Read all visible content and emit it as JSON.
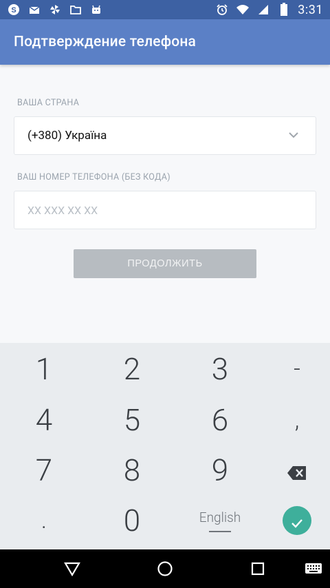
{
  "status_bar": {
    "time": "3:31",
    "left_icons": [
      "skype-icon",
      "mail-check-icon",
      "pinwheel-icon",
      "folder-icon",
      "android-icon"
    ],
    "right_icons": [
      "alarm-icon",
      "wifi-icon",
      "signal-icon",
      "battery-icon"
    ]
  },
  "app_bar": {
    "title": "Подтверждение телефона",
    "color": "#5b80c6"
  },
  "form": {
    "country_label": "ВАША СТРАНА",
    "country_value": "(+380) Україна",
    "phone_label": "ВАШ НОМЕР ТЕЛЕФОНА (БЕЗ КОДА)",
    "phone_value": "",
    "phone_placeholder": "XX XXX XX XX",
    "continue_label": "ПРОДОЛЖИТЬ"
  },
  "keyboard": {
    "k1": "1",
    "k2": "2",
    "k3": "3",
    "dash": "-",
    "k4": "4",
    "k5": "5",
    "k6": "6",
    "comma": ",",
    "k7": "7",
    "k8": "8",
    "k9": "9",
    "dot": ".",
    "k0": "0",
    "language": "English",
    "accent": "#3eaf9b"
  }
}
